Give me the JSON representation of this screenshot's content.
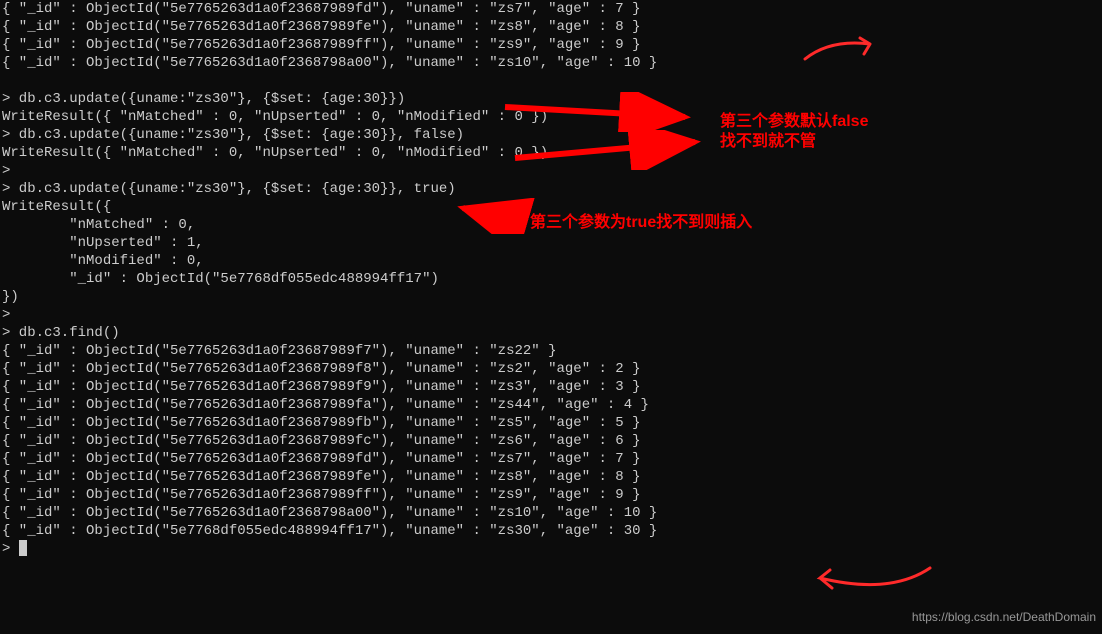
{
  "terminal_lines": [
    "{ \"_id\" : ObjectId(\"5e7765263d1a0f23687989fd\"), \"uname\" : \"zs7\", \"age\" : 7 }",
    "{ \"_id\" : ObjectId(\"5e7765263d1a0f23687989fe\"), \"uname\" : \"zs8\", \"age\" : 8 }",
    "{ \"_id\" : ObjectId(\"5e7765263d1a0f23687989ff\"), \"uname\" : \"zs9\", \"age\" : 9 }",
    "{ \"_id\" : ObjectId(\"5e7765263d1a0f2368798a00\"), \"uname\" : \"zs10\", \"age\" : 10 }",
    "",
    "> db.c3.update({uname:\"zs30\"}, {$set: {age:30}})",
    "WriteResult({ \"nMatched\" : 0, \"nUpserted\" : 0, \"nModified\" : 0 })",
    "> db.c3.update({uname:\"zs30\"}, {$set: {age:30}}, false)",
    "WriteResult({ \"nMatched\" : 0, \"nUpserted\" : 0, \"nModified\" : 0 })",
    ">",
    "> db.c3.update({uname:\"zs30\"}, {$set: {age:30}}, true)",
    "WriteResult({",
    "        \"nMatched\" : 0,",
    "        \"nUpserted\" : 1,",
    "        \"nModified\" : 0,",
    "        \"_id\" : ObjectId(\"5e7768df055edc488994ff17\")",
    "})",
    ">",
    "> db.c3.find()",
    "{ \"_id\" : ObjectId(\"5e7765263d1a0f23687989f7\"), \"uname\" : \"zs22\" }",
    "{ \"_id\" : ObjectId(\"5e7765263d1a0f23687989f8\"), \"uname\" : \"zs2\", \"age\" : 2 }",
    "{ \"_id\" : ObjectId(\"5e7765263d1a0f23687989f9\"), \"uname\" : \"zs3\", \"age\" : 3 }",
    "{ \"_id\" : ObjectId(\"5e7765263d1a0f23687989fa\"), \"uname\" : \"zs44\", \"age\" : 4 }",
    "{ \"_id\" : ObjectId(\"5e7765263d1a0f23687989fb\"), \"uname\" : \"zs5\", \"age\" : 5 }",
    "{ \"_id\" : ObjectId(\"5e7765263d1a0f23687989fc\"), \"uname\" : \"zs6\", \"age\" : 6 }",
    "{ \"_id\" : ObjectId(\"5e7765263d1a0f23687989fd\"), \"uname\" : \"zs7\", \"age\" : 7 }",
    "{ \"_id\" : ObjectId(\"5e7765263d1a0f23687989fe\"), \"uname\" : \"zs8\", \"age\" : 8 }",
    "{ \"_id\" : ObjectId(\"5e7765263d1a0f23687989ff\"), \"uname\" : \"zs9\", \"age\" : 9 }",
    "{ \"_id\" : ObjectId(\"5e7765263d1a0f2368798a00\"), \"uname\" : \"zs10\", \"age\" : 10 }",
    "{ \"_id\" : ObjectId(\"5e7768df055edc488994ff17\"), \"uname\" : \"zs30\", \"age\" : 30 }",
    "> "
  ],
  "annotations": {
    "note1_line1": "第三个参数默认false",
    "note1_line2": "找不到就不管",
    "note2": "第三个参数为true找不到则插入"
  },
  "watermark": "https://blog.csdn.net/DeathDomain"
}
